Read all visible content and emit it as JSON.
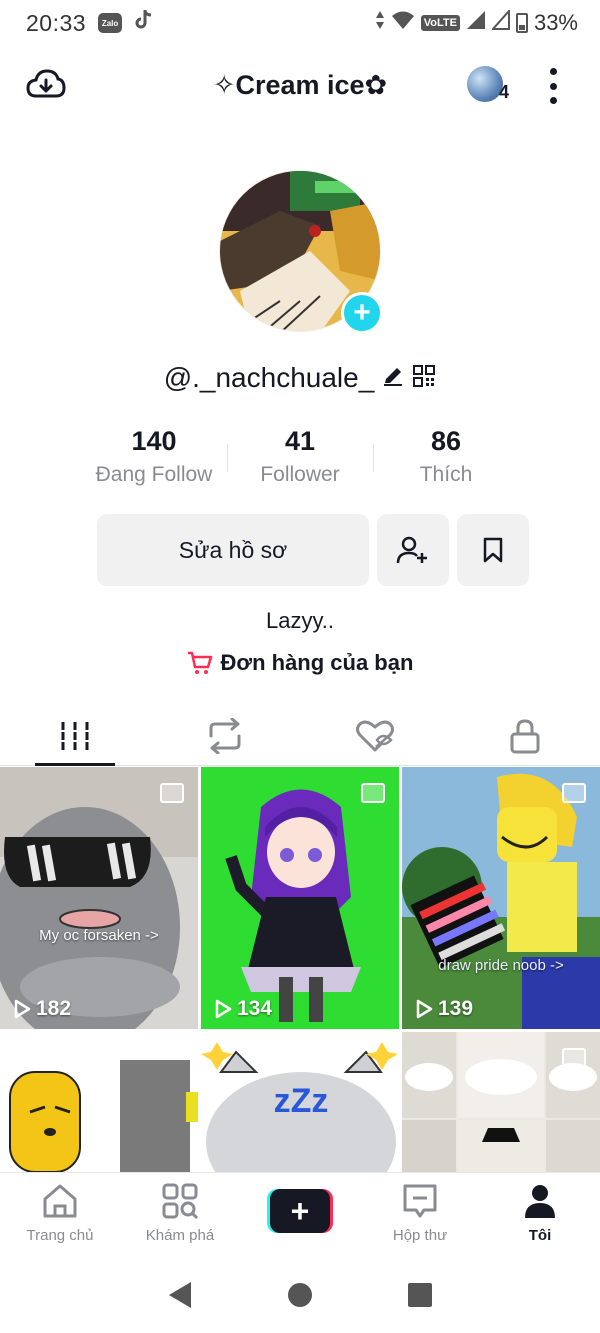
{
  "status_bar": {
    "time": "20:33",
    "zalo_label": "Zalo",
    "network_label": "VoLTE",
    "battery": "33%"
  },
  "header": {
    "title": "✧Cream ice✿",
    "notification_count": "4"
  },
  "profile": {
    "username": "@._nachchuale_",
    "stats": [
      {
        "value": "140",
        "label": "Đang Follow"
      },
      {
        "value": "41",
        "label": "Follower"
      },
      {
        "value": "86",
        "label": "Thích"
      }
    ],
    "edit_button": "Sửa hồ sơ",
    "bio": "Lazyy..",
    "orders_label": "Đơn hàng của bạn"
  },
  "tabs": [
    {
      "icon": "grid-icon",
      "active": true
    },
    {
      "icon": "repost-icon",
      "active": false
    },
    {
      "icon": "liked-hidden-icon",
      "active": false
    },
    {
      "icon": "lock-icon",
      "active": false
    }
  ],
  "videos": [
    {
      "caption": "My oc forsaken ->",
      "views": "182"
    },
    {
      "caption": "",
      "views": "134"
    },
    {
      "caption": "draw pride noob ->",
      "views": "139"
    }
  ],
  "bottom_nav": [
    {
      "label": "Trang chủ",
      "icon": "home-icon",
      "active": false
    },
    {
      "label": "Khám phá",
      "icon": "discover-icon",
      "active": false
    },
    {
      "label": "",
      "icon": "create-icon",
      "active": false
    },
    {
      "label": "Hộp thư",
      "icon": "inbox-icon",
      "active": false
    },
    {
      "label": "Tôi",
      "icon": "profile-icon",
      "active": true
    }
  ],
  "colors": {
    "accent_cyan": "#20d5ec",
    "cart_red": "#fe2c55",
    "text_dark": "#161823",
    "text_muted": "#8a8b91"
  }
}
